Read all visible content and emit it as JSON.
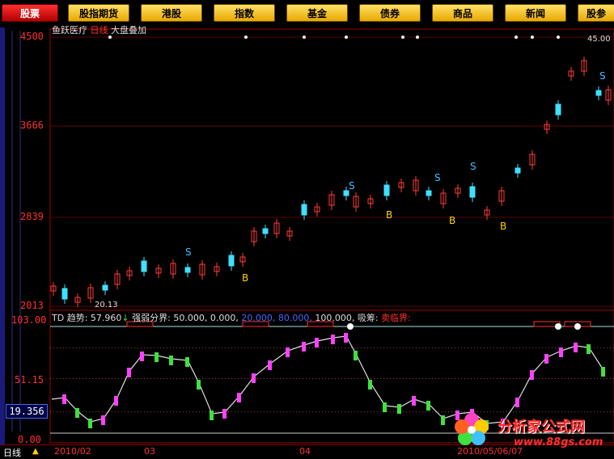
{
  "nav": {
    "items": [
      "股票",
      "股指期货",
      "港股",
      "指数",
      "基金",
      "债券",
      "商品",
      "新闻",
      "股参"
    ],
    "active_index": 0
  },
  "header": {
    "stock_name": "鱼跃医疗",
    "period": "日线",
    "overlay": "大盘叠加"
  },
  "price_axis": {
    "labels": [
      "4500",
      "3666",
      "2839",
      "2013"
    ]
  },
  "annotations": {
    "high_value": "45.00",
    "low_value": "20.13",
    "sell_marker": "S",
    "buy_marker": "B"
  },
  "indicator": {
    "name": "TD",
    "trend_label": "趋势:",
    "trend_value": "57.960",
    "arrow": "↓",
    "bounds_label": "强弱分界:",
    "bounds_values": [
      "50.000,",
      "0.000,",
      "20.000,",
      "80.000,",
      "100.000,"
    ],
    "absorb_label": "吸筹:",
    "sell_label": "卖临界:",
    "axis_labels": [
      "103.00",
      "51.15",
      "0.00"
    ],
    "current_value": "19.356"
  },
  "bottom": {
    "period_tab": "日线",
    "dates": [
      "2010/02",
      "03",
      "04",
      "2010/05/06/07"
    ]
  },
  "watermark": {
    "title": "分析家公式网",
    "url": "www.88gs.com"
  },
  "colors": {
    "up": "#ff3c3c",
    "down": "#40e0ff",
    "pink": "#ff40ff",
    "green": "#40e040"
  }
}
